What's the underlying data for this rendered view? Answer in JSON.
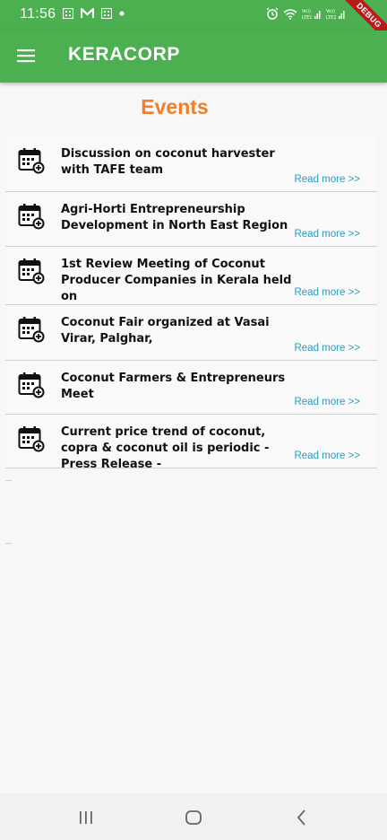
{
  "status_bar": {
    "time": "11:56",
    "debug_label": "DEBUG",
    "lte1_label": "Vo)) LTE1",
    "lte2_label": "Vo)) LTE2"
  },
  "app_bar": {
    "title": "KERACORP",
    "menu_icon": "hamburger-menu-icon"
  },
  "page": {
    "heading": "Events"
  },
  "events": [
    {
      "title": "Discussion on coconut harvester with TAFE team",
      "link": "Read more >>",
      "icon": "calendar-icon"
    },
    {
      "title": "Agri-Horti Entrepreneurship Development in North East Region",
      "link": "Read more >>",
      "icon": "calendar-icon"
    },
    {
      "title": "1st Review Meeting of Coconut Producer Companies in Kerala held on",
      "link": "Read more >>",
      "icon": "calendar-icon"
    },
    {
      "title": "Coconut Fair organized at Vasai Virar, Palghar,",
      "link": "Read more >>",
      "icon": "calendar-icon"
    },
    {
      "title": "Coconut Farmers & Entrepreneurs Meet",
      "link": "Read more >>",
      "icon": "calendar-icon"
    },
    {
      "title": "Current price trend of coconut, copra & coconut oil is periodic - Press Release -",
      "link": "Read more >>",
      "icon": "calendar-icon"
    }
  ],
  "colors": {
    "primary": "#4caf50",
    "heading": "#ef7f2d",
    "link": "#2a9bbf"
  }
}
